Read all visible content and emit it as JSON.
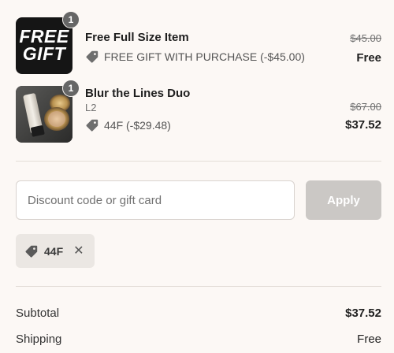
{
  "items": [
    {
      "quantity": "1",
      "thumb_line1": "FREE",
      "thumb_line2": "GIFT",
      "title": "Free Full Size Item",
      "variant": "",
      "discount_label": "FREE GIFT WITH PURCHASE (-$45.00)",
      "original_price": "$45.00",
      "final_price": "Free"
    },
    {
      "quantity": "1",
      "title": "Blur the Lines Duo",
      "variant": "L2",
      "discount_label": "44F (-$29.48)",
      "original_price": "$67.00",
      "final_price": "$37.52"
    }
  ],
  "discount": {
    "placeholder": "Discount code or gift card",
    "apply_label": "Apply",
    "applied_code": "44F",
    "remove_glyph": "✕"
  },
  "summary": {
    "subtotal_label": "Subtotal",
    "subtotal_value": "$37.52",
    "shipping_label": "Shipping",
    "shipping_value": "Free"
  },
  "icons": {
    "tag": "tag-icon",
    "remove": "close-icon"
  },
  "colors": {
    "background": "#fcf8f5",
    "apply_button": "#cbc8c5",
    "badge": "#666666",
    "chip": "#ebe7e3"
  }
}
